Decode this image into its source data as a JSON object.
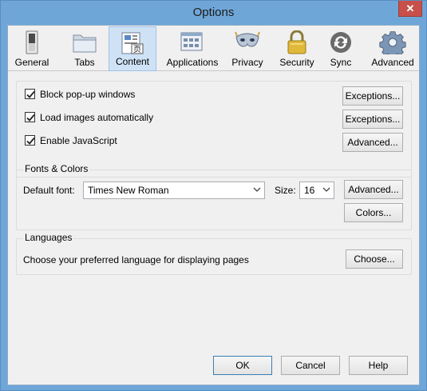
{
  "window": {
    "title": "Options",
    "close_glyph": "✕"
  },
  "toolbar": {
    "items": [
      {
        "label": "General",
        "icon": "switch-icon"
      },
      {
        "label": "Tabs",
        "icon": "folder-tabs-icon"
      },
      {
        "label": "Content",
        "icon": "content-page-icon",
        "selected": true
      },
      {
        "label": "Applications",
        "icon": "applications-icon"
      },
      {
        "label": "Privacy",
        "icon": "mask-icon"
      },
      {
        "label": "Security",
        "icon": "padlock-icon"
      },
      {
        "label": "Sync",
        "icon": "sync-icon"
      },
      {
        "label": "Advanced",
        "icon": "gear-icon"
      }
    ]
  },
  "content": {
    "block_popups_label": "Block pop-up windows",
    "load_images_label": "Load images automatically",
    "enable_js_label": "Enable JavaScript",
    "block_popups_checked": true,
    "load_images_checked": true,
    "enable_js_checked": true,
    "exceptions_label": "Exceptions...",
    "advanced_label": "Advanced..."
  },
  "fonts": {
    "group_title": "Fonts & Colors",
    "default_font_label": "Default font:",
    "default_font_value": "Times New Roman",
    "size_label": "Size:",
    "size_value": "16",
    "advanced_label": "Advanced...",
    "colors_label": "Colors..."
  },
  "languages": {
    "group_title": "Languages",
    "description": "Choose your preferred language for displaying pages",
    "choose_label": "Choose..."
  },
  "footer": {
    "ok_label": "OK",
    "cancel_label": "Cancel",
    "help_label": "Help"
  },
  "colors": {
    "titlebar": "#6fa6d8",
    "close": "#c7504a",
    "selected_tab": "#cfe2f5"
  }
}
